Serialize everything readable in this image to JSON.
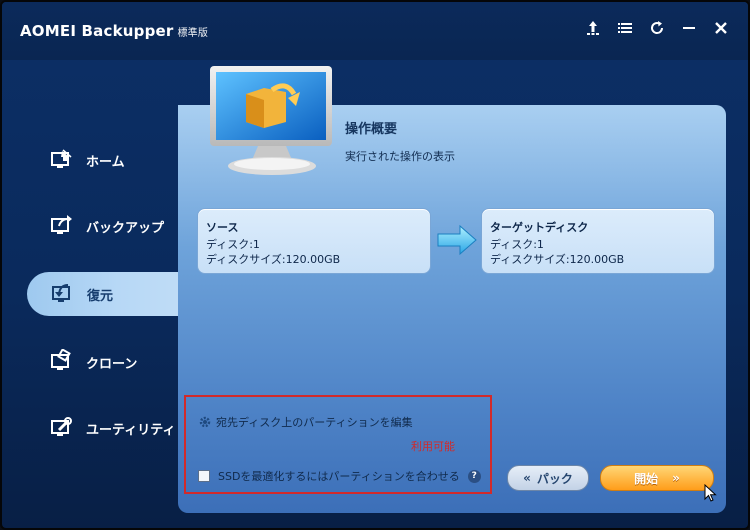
{
  "window": {
    "title": "AOMEI Backupper",
    "edition": "標準版"
  },
  "sidebar": {
    "items": [
      {
        "label": "ホーム",
        "icon": "home-icon"
      },
      {
        "label": "バックアップ",
        "icon": "backup-icon"
      },
      {
        "label": "復元",
        "icon": "restore-icon",
        "active": true
      },
      {
        "label": "クローン",
        "icon": "clone-icon"
      },
      {
        "label": "ユーティリティ",
        "icon": "utility-icon"
      }
    ]
  },
  "summary": {
    "title": "操作概要",
    "subtitle": "実行された操作の表示"
  },
  "source": {
    "label": "ソース",
    "disk": "ディスク:1",
    "size": "ディスクサイズ:120.00GB"
  },
  "target": {
    "label": "ターゲットディスク",
    "disk": "ディスク:1",
    "size": "ディスクサイズ:120.00GB"
  },
  "options": {
    "edit_partitions": "宛先ディスク上のパーティションを編集",
    "available": "利用可能",
    "ssd_align": "SSDを最適化するにはパーティションを合わせる",
    "help": "?"
  },
  "buttons": {
    "back": "パック",
    "back_arrows": "«",
    "start": "開始",
    "start_arrows": "»"
  },
  "colors": {
    "accent_orange": "#ff9d1a",
    "highlight_red": "#d22a2a",
    "window_blue": "#0a2a5c"
  }
}
